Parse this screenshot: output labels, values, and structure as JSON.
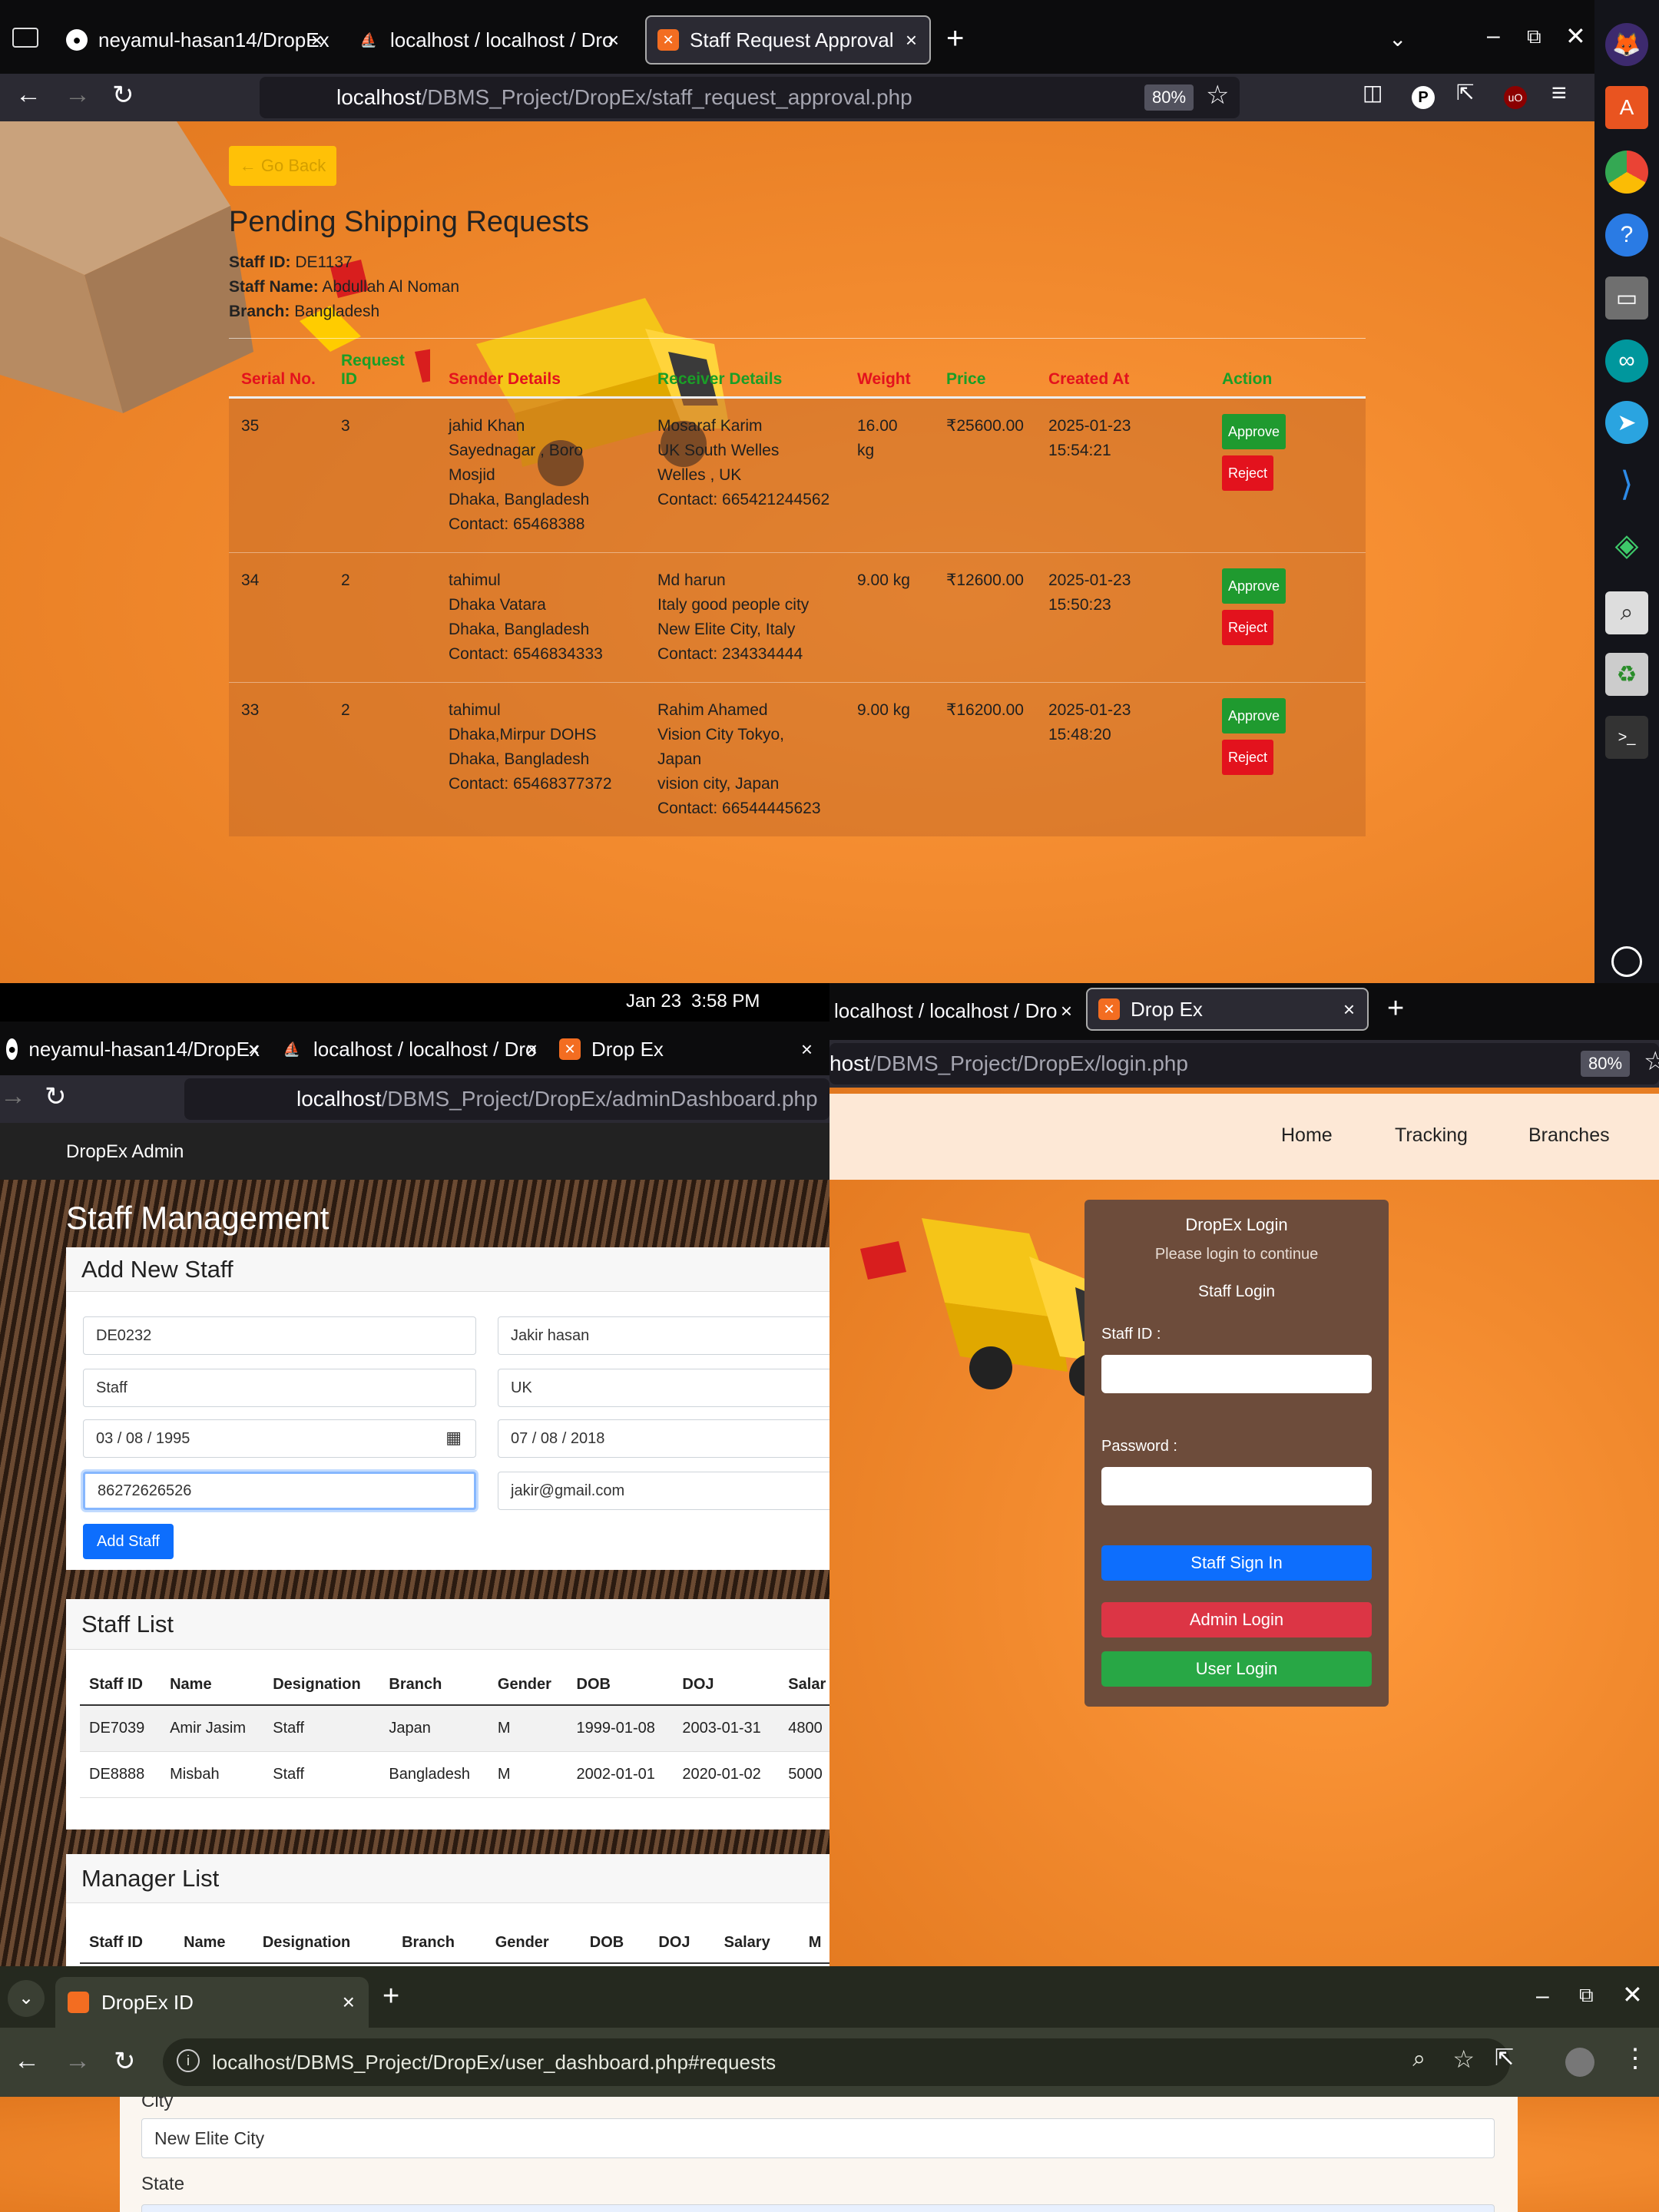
{
  "top_window": {
    "tabs": [
      {
        "label": "neyamul-hasan14/DropEx",
        "icon": "github-icon"
      },
      {
        "label": "localhost / localhost / Dro",
        "icon": "phpmyadmin-icon"
      },
      {
        "label": "Staff Request Approval",
        "icon": "xampp-icon"
      }
    ],
    "url_host": "localhost",
    "url_path": "/DBMS_Project/DropEx/staff_request_approval.php",
    "zoom": "80%",
    "go_back": "← Go Back",
    "title": "Pending Shipping Requests",
    "staff_id_label": "Staff ID:",
    "staff_id": "DE1137",
    "staff_name_label": "Staff Name:",
    "staff_name": "Abdullah Al Noman",
    "branch_label": "Branch:",
    "branch": "Bangladesh",
    "headers": [
      "Serial No.",
      "Request ID",
      "Sender Details",
      "Receiver Details",
      "Weight",
      "Price",
      "Created At",
      "Action"
    ],
    "rows": [
      {
        "serial": "35",
        "req": "3",
        "sender": [
          "jahid Khan",
          "Sayednagar , Boro",
          "Mosjid",
          "Dhaka, Bangladesh",
          "Contact: 65468388"
        ],
        "receiver": [
          "Mosaraf Karim",
          "UK South Welles",
          "Welles , UK",
          "Contact: 665421244562"
        ],
        "weight": [
          "16.00",
          "kg"
        ],
        "price": "₹25600.00",
        "created": [
          "2025-01-23",
          "15:54:21"
        ]
      },
      {
        "serial": "34",
        "req": "2",
        "sender": [
          "tahimul",
          "Dhaka Vatara",
          "Dhaka, Bangladesh",
          "Contact: 6546834333"
        ],
        "receiver": [
          "Md harun",
          "Italy good people city",
          "New Elite City, Italy",
          "Contact: 234334444"
        ],
        "weight": [
          "9.00 kg"
        ],
        "price": "₹12600.00",
        "created": [
          "2025-01-23",
          "15:50:23"
        ]
      },
      {
        "serial": "33",
        "req": "2",
        "sender": [
          "tahimul",
          "Dhaka,Mirpur DOHS",
          "Dhaka, Bangladesh",
          "Contact: 65468377372"
        ],
        "receiver": [
          "Rahim Ahamed",
          "Vision City Tokyo,",
          "Japan",
          "vision city, Japan",
          "Contact: 66544445623"
        ],
        "weight": [
          "9.00 kg"
        ],
        "price": "₹16200.00",
        "created": [
          "2025-01-23",
          "15:48:20"
        ]
      }
    ],
    "approve": "Approve",
    "reject": "Reject"
  },
  "clock": {
    "date": "Jan 23",
    "time": "3:58 PM"
  },
  "admin_window": {
    "tabs": [
      "neyamul-hasan14/DropEx",
      "localhost / localhost / Dro",
      "Drop Ex"
    ],
    "url_host": "localhost",
    "url_path": "/DBMS_Project/DropEx/adminDashboard.php",
    "brand": "DropEx Admin",
    "heading": "Staff Management",
    "add_title": "Add New Staff",
    "fields": [
      "DE0232",
      "Jakir hasan",
      "Staff",
      "UK",
      "03 / 08 / 1995",
      "07 / 08 / 2018",
      "86272626526",
      "jakir@gmail.com"
    ],
    "add_button": "Add Staff",
    "staff_list_title": "Staff List",
    "staff_headers": [
      "Staff ID",
      "Name",
      "Designation",
      "Branch",
      "Gender",
      "DOB",
      "DOJ",
      "Salar"
    ],
    "staff_rows": [
      [
        "DE7039",
        "Amir Jasim",
        "Staff",
        "Japan",
        "M",
        "1999-01-08",
        "2003-01-31",
        "4800"
      ],
      [
        "DE8888",
        "Misbah",
        "Staff",
        "Bangladesh",
        "M",
        "2002-01-01",
        "2020-01-02",
        "5000"
      ]
    ],
    "manager_list_title": "Manager List",
    "manager_headers": [
      "Staff ID",
      "Name",
      "Designation",
      "Branch",
      "Gender",
      "DOB",
      "DOJ",
      "Salary",
      "M"
    ]
  },
  "login_window": {
    "tabs": [
      "localhost / localhost / Dro",
      "Drop Ex"
    ],
    "url_host": "host",
    "url_path": "/DBMS_Project/DropEx/login.php",
    "zoom": "80%",
    "nav": [
      "Home",
      "Tracking",
      "Branches"
    ],
    "title": "DropEx Login",
    "subtitle": "Please login to continue",
    "section": "Staff Login",
    "staff_id_label": "Staff ID :",
    "password_label": "Password :",
    "staff_signin": "Staff Sign In",
    "admin_login": "Admin Login",
    "user_login": "User Login"
  },
  "chrome_window": {
    "tab": "DropEx ID",
    "url": "localhost/DBMS_Project/DropEx/user_dashboard.php#requests",
    "city_label": "City",
    "city_value": "New Elite City",
    "state_label": "State"
  },
  "colors": {
    "accent_orange": "#f28a2e",
    "approve": "#1f9a2f",
    "reject": "#e3121d",
    "primary": "#0d6efd"
  }
}
